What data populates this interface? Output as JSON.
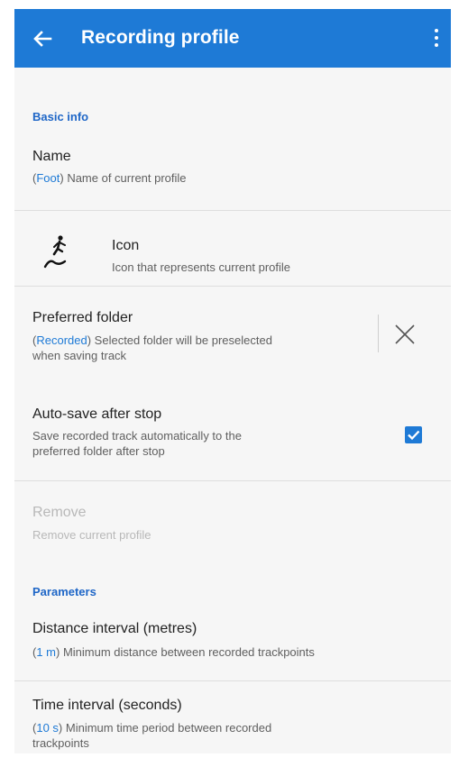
{
  "appbar": {
    "title": "Recording profile",
    "back_icon": "arrow-left-icon",
    "menu_icon": "more-vert-icon",
    "color": "#1e7ad6"
  },
  "sections": {
    "basic_info": "Basic info",
    "parameters": "Parameters"
  },
  "name": {
    "title": "Name",
    "value": "Foot",
    "subtitle": "Name of current profile"
  },
  "icon_item": {
    "title": "Icon",
    "subtitle": "Icon that represents current profile",
    "icon": "hiking-track-icon"
  },
  "preferred_folder": {
    "title": "Preferred folder",
    "value": "Recorded",
    "subtitle_line1": "Selected folder will be preselected",
    "subtitle_line2": "when saving track",
    "clear_icon": "close-icon"
  },
  "auto_save": {
    "title": "Auto-save after stop",
    "subtitle_line1": "Save recorded track automatically to the",
    "subtitle_line2": "preferred folder after stop",
    "checked": true
  },
  "remove": {
    "title": "Remove",
    "subtitle": "Remove current profile",
    "enabled": false
  },
  "distance_interval": {
    "title": "Distance interval (metres)",
    "value": "1 m",
    "subtitle": "Minimum distance between recorded trackpoints"
  },
  "time_interval": {
    "title": "Time interval (seconds)",
    "value": "10 s",
    "subtitle_line1": "Minimum time period between recorded",
    "subtitle_line2": "trackpoints"
  }
}
